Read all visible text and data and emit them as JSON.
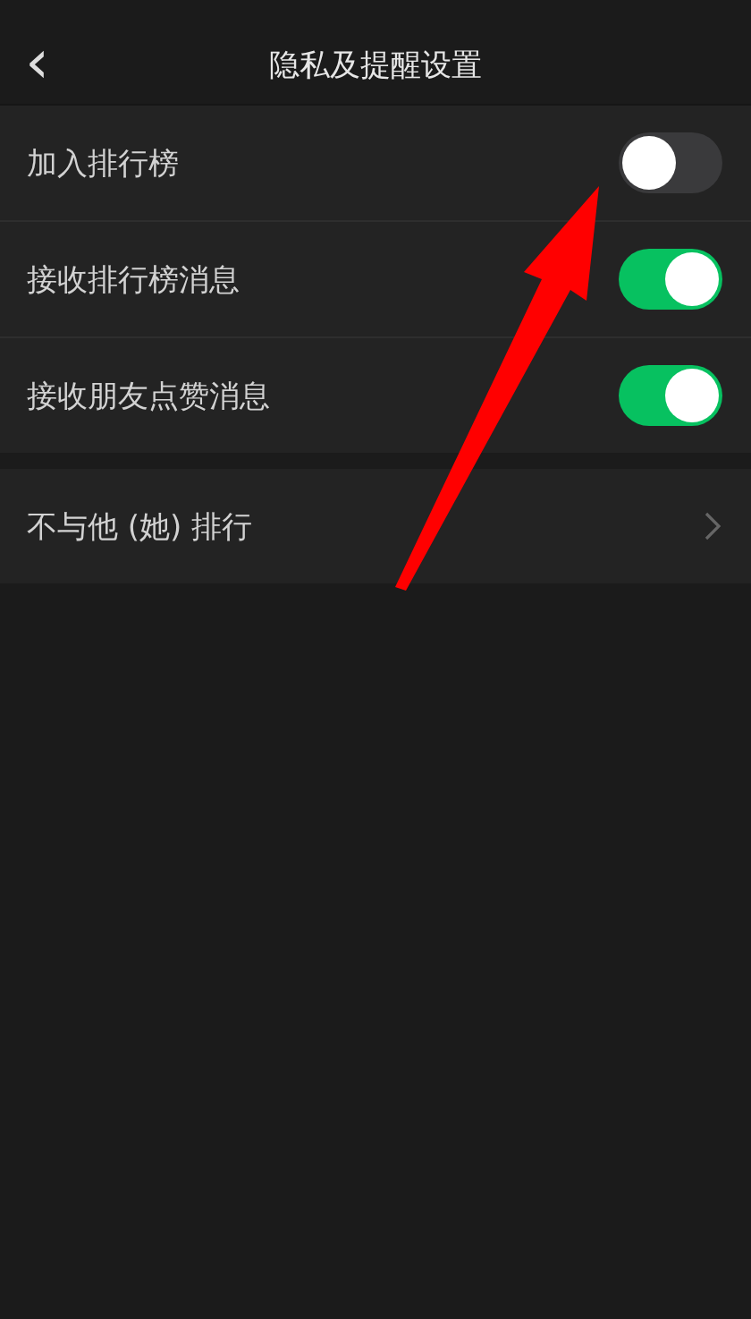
{
  "header": {
    "back_icon": "‹",
    "title": "隐私及提醒设置"
  },
  "settings": [
    {
      "kind": "toggle",
      "label": "加入排行榜",
      "on": false
    },
    {
      "kind": "toggle",
      "label": "接收排行榜消息",
      "on": true
    },
    {
      "kind": "toggle",
      "label": "接收朋友点赞消息",
      "on": true
    }
  ],
  "links": [
    {
      "kind": "link",
      "label": "不与他 (她) 排行"
    }
  ],
  "annotation": {
    "kind": "arrow"
  }
}
